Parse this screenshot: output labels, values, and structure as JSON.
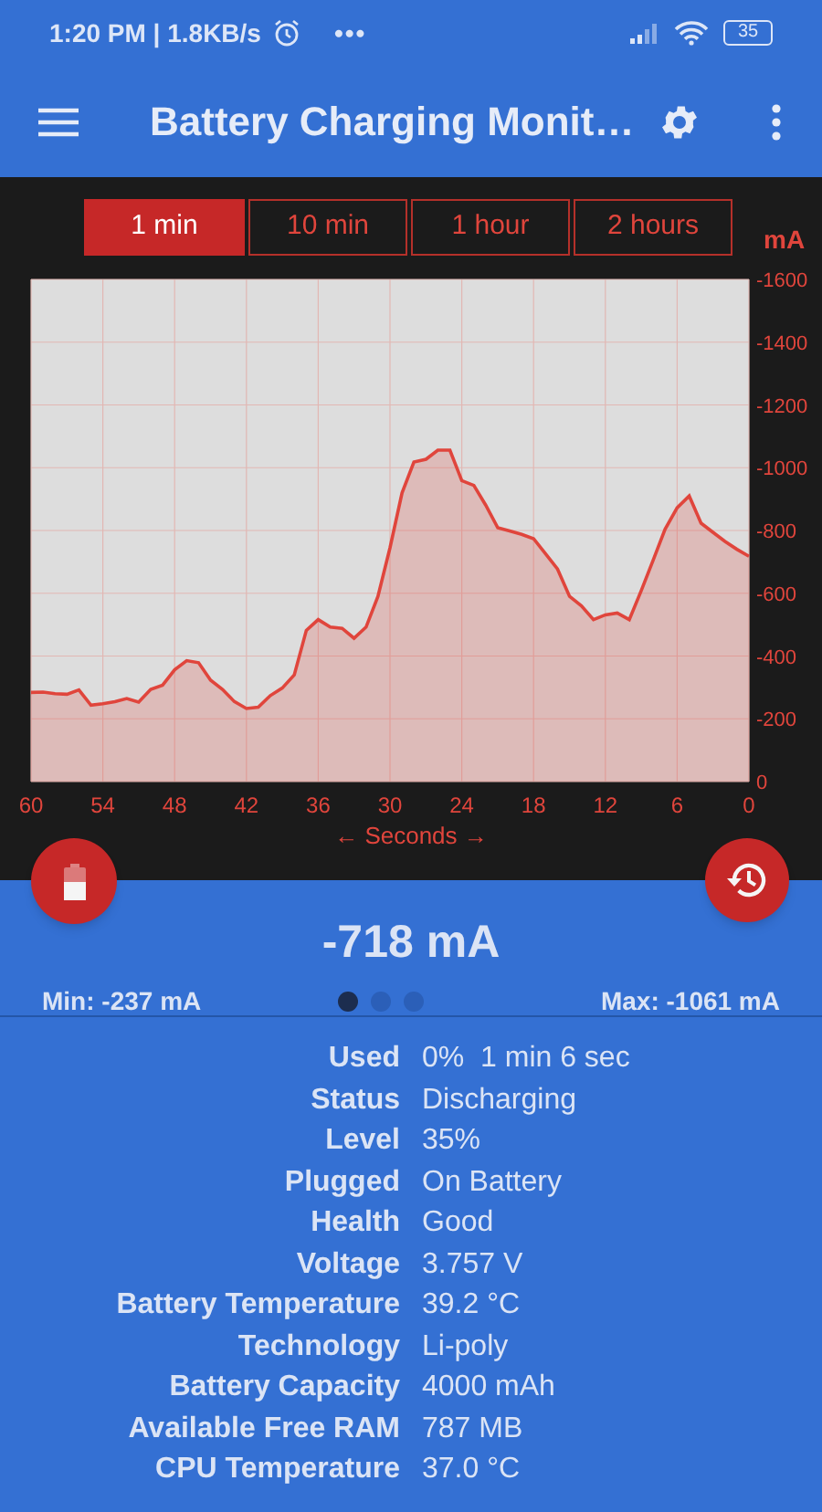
{
  "status_bar": {
    "time": "1:20 PM | 1.8KB/s",
    "more": "•••",
    "battery": "35"
  },
  "app_bar": {
    "title": "Battery Charging Monit…"
  },
  "range_tabs": [
    {
      "label": "1 min",
      "selected": true
    },
    {
      "label": "10 min",
      "selected": false
    },
    {
      "label": "1 hour",
      "selected": false
    },
    {
      "label": "2 hours",
      "selected": false
    }
  ],
  "chart": {
    "chart_data": {
      "type": "area",
      "xlabel": "← Seconds →",
      "ylabel": "mA",
      "x": [
        60,
        59,
        58,
        57,
        56,
        55,
        54,
        53,
        52,
        51,
        50,
        49,
        48,
        47,
        46,
        45,
        44,
        43,
        42,
        41,
        40,
        39,
        38,
        37,
        36,
        35,
        34,
        33,
        32,
        31,
        30,
        29,
        28,
        27,
        26,
        25,
        24,
        23,
        22,
        21,
        20,
        19,
        18,
        17,
        16,
        15,
        14,
        13,
        12,
        11,
        10,
        9,
        8,
        7,
        6,
        5,
        4,
        3,
        2,
        1,
        0
      ],
      "grid": true,
      "series": [
        {
          "color": "#e0453c",
          "values": [
            -284,
            -285,
            -280,
            -278,
            -292,
            -243,
            -248,
            -255,
            -265,
            -253,
            -294,
            -307,
            -356,
            -385,
            -379,
            -323,
            -294,
            -255,
            -233,
            -237,
            -274,
            -298,
            -340,
            -482,
            -516,
            -492,
            -488,
            -457,
            -492,
            -590,
            -745,
            -920,
            -1018,
            -1027,
            -1056,
            -1056,
            -959,
            -944,
            -881,
            -809,
            -798,
            -788,
            -774,
            -726,
            -677,
            -590,
            -560,
            -516,
            -531,
            -537,
            -516,
            -609,
            -706,
            -804,
            -872,
            -910,
            -823,
            -794,
            -765,
            -740,
            -718
          ]
        }
      ],
      "xlim": [
        60,
        0
      ],
      "ylim": [
        0,
        -1600
      ],
      "xticks": [
        60,
        54,
        48,
        42,
        36,
        30,
        24,
        18,
        12,
        6,
        0
      ],
      "yticks": [
        0,
        -200,
        -400,
        -600,
        -800,
        -1000,
        -1200,
        -1400,
        -1600
      ]
    }
  },
  "current": {
    "value": "-718 mA",
    "min": "Min: -237 mA",
    "max": "Max: -1061 mA"
  },
  "pager": [
    {
      "selected": true
    },
    {
      "selected": false
    },
    {
      "selected": false
    }
  ],
  "details": [
    {
      "label": "Used",
      "value": "0%  1 min 6 sec"
    },
    {
      "label": "Status",
      "value": "Discharging"
    },
    {
      "label": "Level",
      "value": "35%"
    },
    {
      "label": "Plugged",
      "value": "On Battery"
    },
    {
      "label": "Health",
      "value": "Good"
    },
    {
      "label": "Voltage",
      "value": "3.757 V"
    },
    {
      "label": "Battery Temperature",
      "value": "39.2 °C"
    },
    {
      "label": "Technology",
      "value": "Li-poly"
    },
    {
      "label": "Battery Capacity",
      "value": "4000 mAh"
    },
    {
      "label": "Available Free RAM",
      "value": "787 MB"
    },
    {
      "label": "CPU Temperature",
      "value": "37.0 °C"
    }
  ]
}
